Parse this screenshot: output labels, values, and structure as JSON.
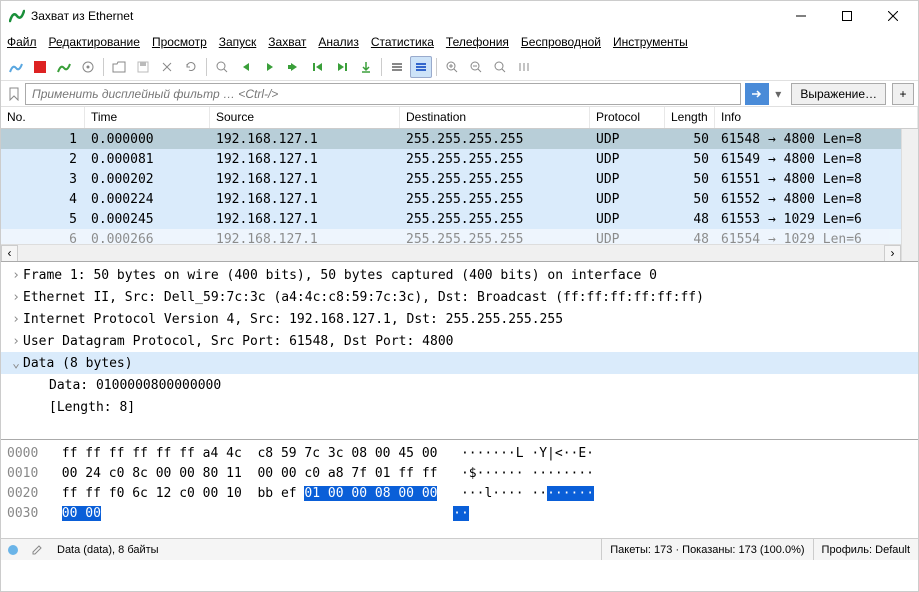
{
  "title": "Захват из Ethernet",
  "menu": [
    "Файл",
    "Редактирование",
    "Просмотр",
    "Запуск",
    "Захват",
    "Анализ",
    "Статистика",
    "Телефония",
    "Беспроводной",
    "Инструменты"
  ],
  "filter_placeholder": "Применить дисплейный фильтр … <Ctrl-/>",
  "expression_btn": "Выражение…",
  "columns": {
    "no": "No.",
    "time": "Time",
    "source": "Source",
    "dest": "Destination",
    "proto": "Protocol",
    "len": "Length",
    "info": "Info"
  },
  "rows": [
    {
      "no": "1",
      "time": "0.000000",
      "src": "192.168.127.1",
      "dst": "255.255.255.255",
      "proto": "UDP",
      "len": "50",
      "info": "61548 → 4800 Len=8",
      "sel": true
    },
    {
      "no": "2",
      "time": "0.000081",
      "src": "192.168.127.1",
      "dst": "255.255.255.255",
      "proto": "UDP",
      "len": "50",
      "info": "61549 → 4800 Len=8"
    },
    {
      "no": "3",
      "time": "0.000202",
      "src": "192.168.127.1",
      "dst": "255.255.255.255",
      "proto": "UDP",
      "len": "50",
      "info": "61551 → 4800 Len=8"
    },
    {
      "no": "4",
      "time": "0.000224",
      "src": "192.168.127.1",
      "dst": "255.255.255.255",
      "proto": "UDP",
      "len": "50",
      "info": "61552 → 4800 Len=8"
    },
    {
      "no": "5",
      "time": "0.000245",
      "src": "192.168.127.1",
      "dst": "255.255.255.255",
      "proto": "UDP",
      "len": "48",
      "info": "61553 → 1029 Len=6"
    },
    {
      "no": "6",
      "time": "0.000266",
      "src": "192.168.127.1",
      "dst": "255.255.255.255",
      "proto": "UDP",
      "len": "48",
      "info": "61554 → 1029 Len=6",
      "cut": true
    }
  ],
  "details": [
    {
      "t": ">",
      "text": "Frame 1: 50 bytes on wire (400 bits), 50 bytes captured (400 bits) on interface 0"
    },
    {
      "t": ">",
      "text": "Ethernet II, Src: Dell_59:7c:3c (a4:4c:c8:59:7c:3c), Dst: Broadcast (ff:ff:ff:ff:ff:ff)"
    },
    {
      "t": ">",
      "text": "Internet Protocol Version 4, Src: 192.168.127.1, Dst: 255.255.255.255"
    },
    {
      "t": ">",
      "text": "User Datagram Protocol, Src Port: 61548, Dst Port: 4800"
    },
    {
      "t": "v",
      "text": "Data (8 bytes)",
      "hl": true
    },
    {
      "t": "",
      "text": "Data: 0100000800000000",
      "indent": true
    },
    {
      "t": "",
      "text": "[Length: 8]",
      "indent": true
    }
  ],
  "hex": {
    "l0_off": "0000",
    "l0_hex": "ff ff ff ff ff ff a4 4c  c8 59 7c 3c 08 00 45 00",
    "l0_asc": "·······L ·Y|<··E·",
    "l1_off": "0010",
    "l1_hex": "00 24 c0 8c 00 00 80 11  00 00 c0 a8 7f 01 ff ff",
    "l1_asc": "·$······ ········",
    "l2_off": "0020",
    "l2_hex_a": "ff ff f0 6c 12 c0 00 10  bb ef ",
    "l2_hex_sel": "01 00 00 08 00 00",
    "l2_asc_a": "···l···· ··",
    "l2_asc_sel": "······",
    "l3_off": "0030",
    "l3_hex_sel": "00 00",
    "l3_asc_sel": "··"
  },
  "status": {
    "main": "Data (data), 8 байты",
    "packets": "Пакеты: 173 · Показаны: 173 (100.0%)",
    "profile": "Профиль: Default"
  }
}
